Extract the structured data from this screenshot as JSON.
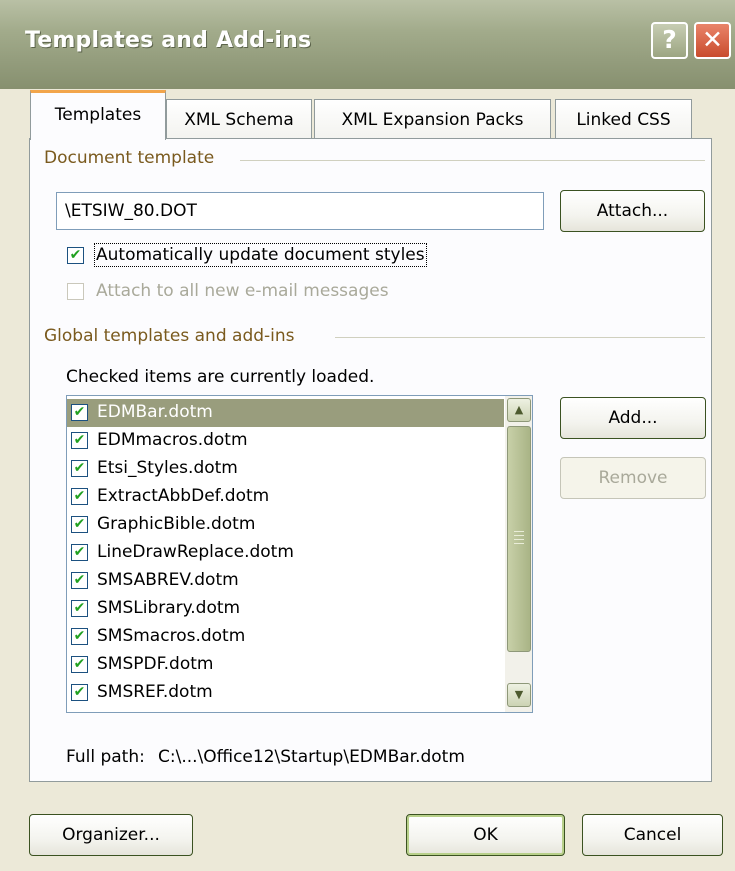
{
  "window": {
    "title": "Templates and Add-ins",
    "help_glyph": "?",
    "close_glyph": "✕"
  },
  "tabs": [
    {
      "label": "Templates",
      "active": true
    },
    {
      "label": "XML Schema",
      "active": false
    },
    {
      "label": "XML Expansion Packs",
      "active": false
    },
    {
      "label": "Linked CSS",
      "active": false
    }
  ],
  "document_template": {
    "group_label": "Document template",
    "path_value": "\\ETSIW_80.DOT",
    "attach_label": "Attach...",
    "auto_update_label": "Automatically update document styles",
    "auto_update_checked": true,
    "attach_email_label": "Attach to all new e-mail messages",
    "attach_email_checked": false,
    "attach_email_enabled": false
  },
  "global": {
    "group_label": "Global templates and add-ins",
    "hint": "Checked items are currently loaded.",
    "items": [
      {
        "label": "EDMBar.dotm",
        "checked": true,
        "selected": true
      },
      {
        "label": "EDMmacros.dotm",
        "checked": true,
        "selected": false
      },
      {
        "label": "Etsi_Styles.dotm",
        "checked": true,
        "selected": false
      },
      {
        "label": "ExtractAbbDef.dotm",
        "checked": true,
        "selected": false
      },
      {
        "label": "GraphicBible.dotm",
        "checked": true,
        "selected": false
      },
      {
        "label": "LineDrawReplace.dotm",
        "checked": true,
        "selected": false
      },
      {
        "label": "SMSABREV.dotm",
        "checked": true,
        "selected": false
      },
      {
        "label": "SMSLibrary.dotm",
        "checked": true,
        "selected": false
      },
      {
        "label": "SMSmacros.dotm",
        "checked": true,
        "selected": false
      },
      {
        "label": "SMSPDF.dotm",
        "checked": true,
        "selected": false
      },
      {
        "label": "SMSREF.dotm",
        "checked": true,
        "selected": false
      }
    ],
    "add_label": "Add...",
    "remove_label": "Remove",
    "remove_enabled": false,
    "full_path_label": "Full path:",
    "full_path_value": "C:\\...\\Office12\\Startup\\EDMBar.dotm"
  },
  "footer": {
    "organizer_label": "Organizer...",
    "ok_label": "OK",
    "cancel_label": "Cancel"
  },
  "colors": {
    "titlebar": "#939c7c",
    "dialog_bg": "#ece9d8",
    "selection": "#999d7d",
    "check": "#21a121"
  },
  "icons": {
    "check": "✔",
    "scroll_up": "▲",
    "scroll_down": "▼"
  }
}
